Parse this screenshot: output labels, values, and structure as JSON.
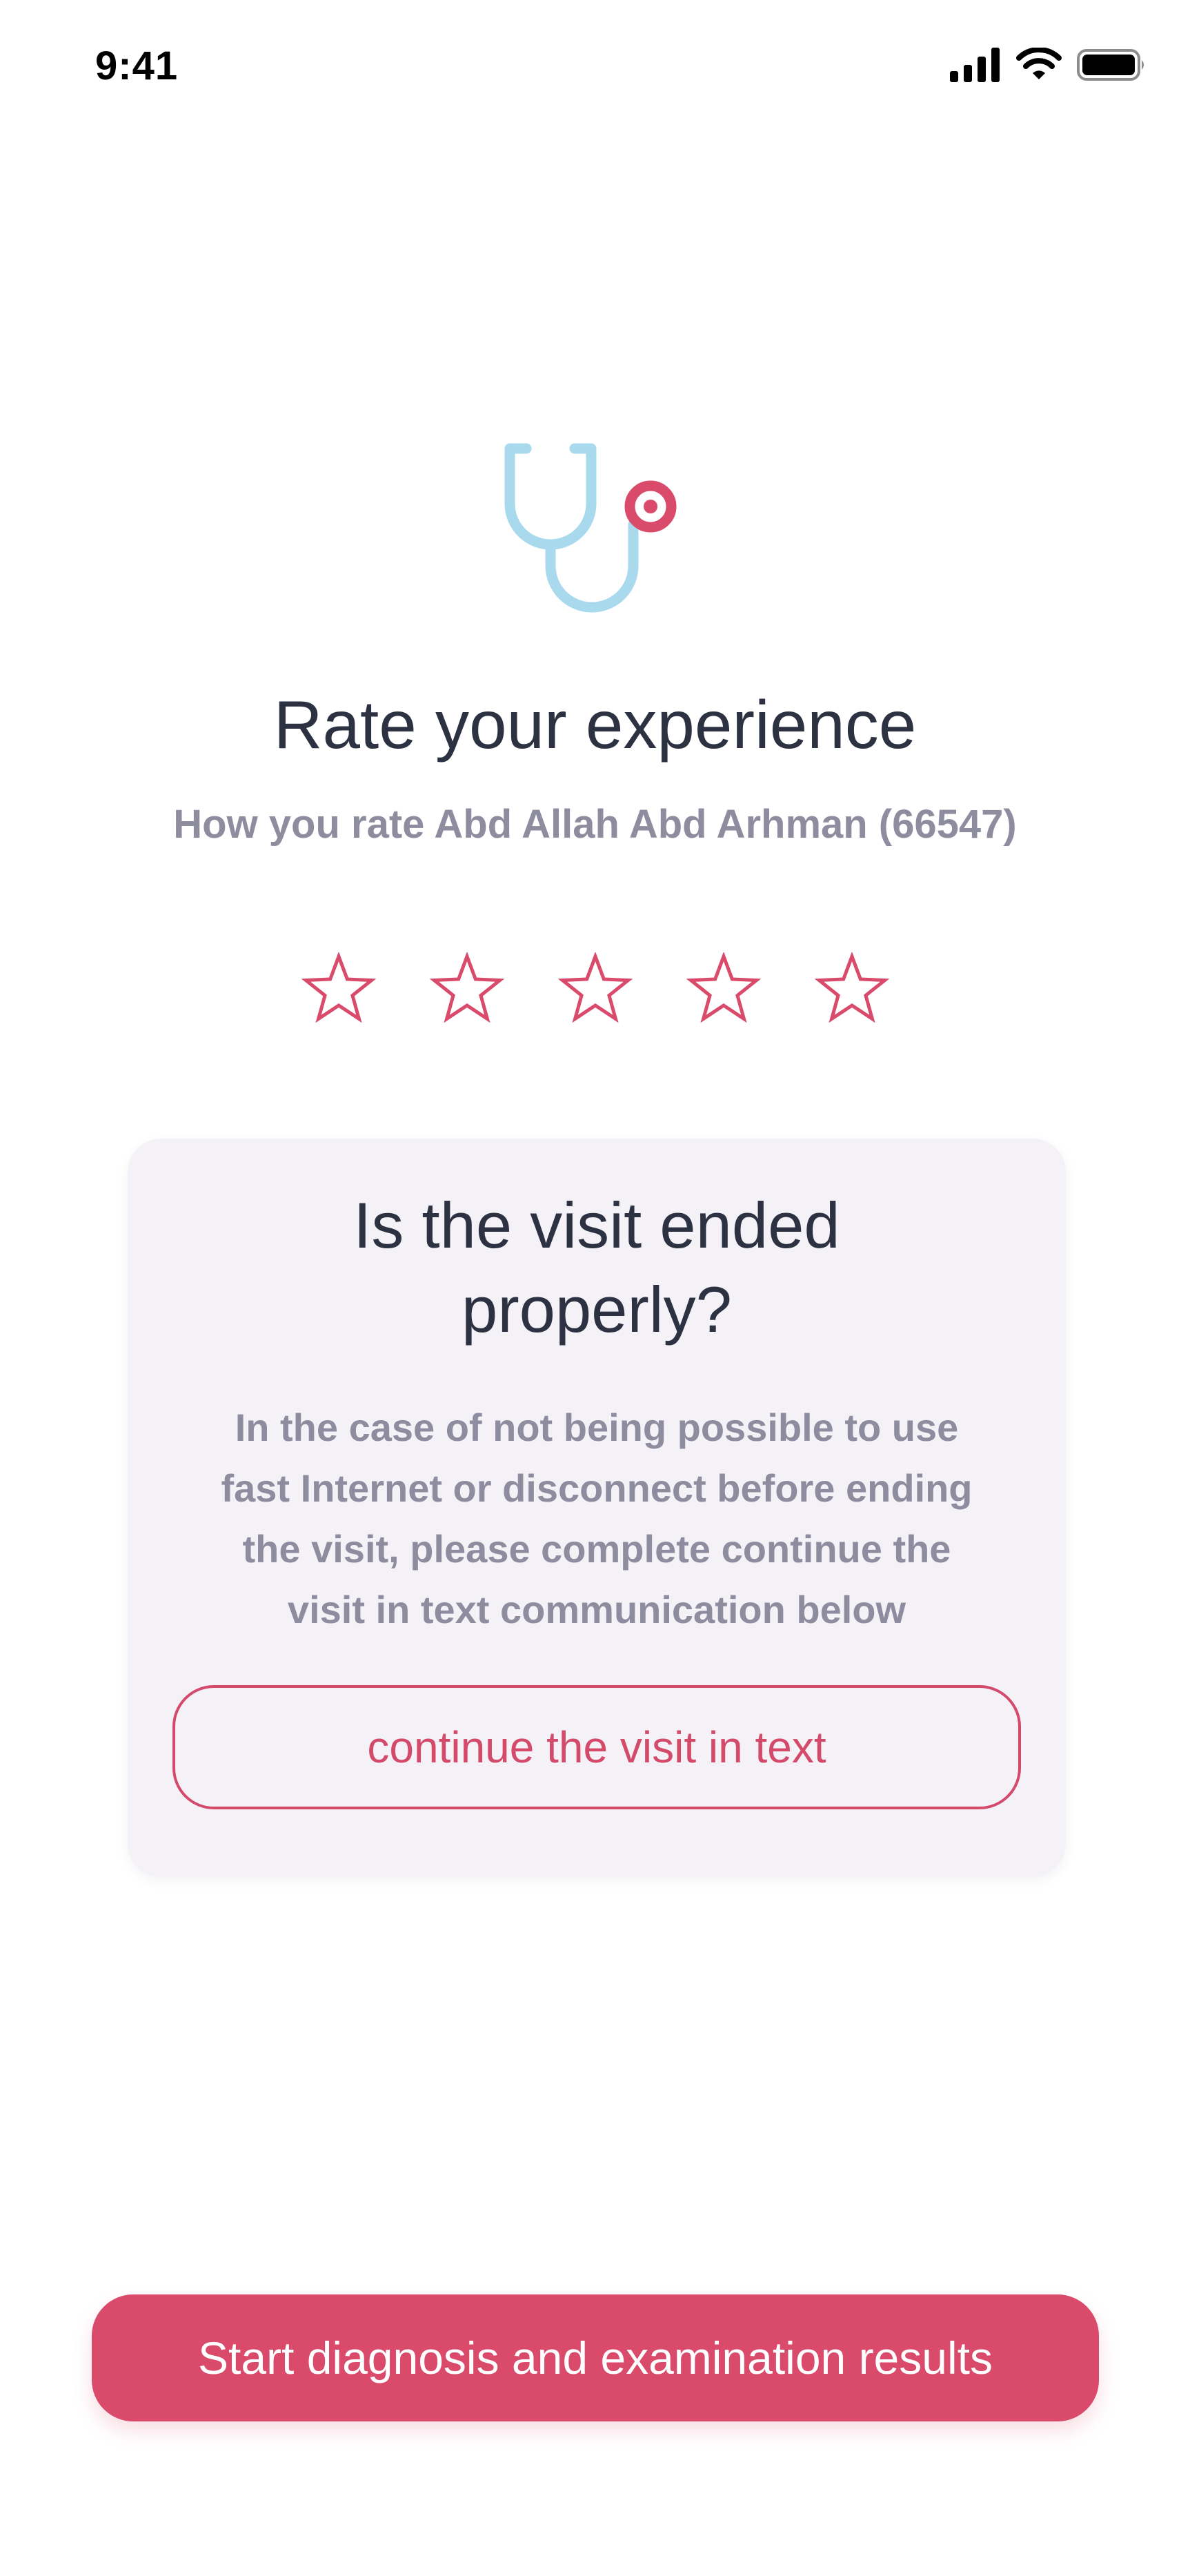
{
  "status_bar": {
    "time": "9:41",
    "icons": [
      "cellular-signal-icon",
      "wifi-icon",
      "battery-icon"
    ]
  },
  "hero": {
    "icon": "stethoscope-icon"
  },
  "rating": {
    "title": "Rate your experience",
    "subtitle": "How you rate Abd Allah Abd Arhman (66547)",
    "max_stars": 5,
    "selected_stars": 0
  },
  "visit_card": {
    "title_line1": "Is the visit ended",
    "title_line2": "properly?",
    "body": "In the case of not being possible to use fast Internet or disconnect before ending the visit, please complete continue the visit in text communication below",
    "button_label": "continue the visit in text"
  },
  "footer": {
    "primary_button_label": "Start diagnosis and examination results"
  },
  "colors": {
    "accent": "#d94a6b",
    "stethoscope_blue": "#a8d9ec",
    "heading": "#2d3242",
    "muted_text": "#8e8d9f",
    "card_background": "#f4f2f7"
  }
}
